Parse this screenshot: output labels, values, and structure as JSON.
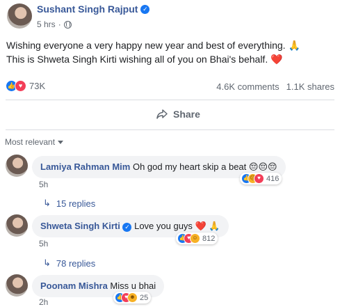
{
  "post": {
    "author": "Sushant Singh Rajput",
    "time": "5 hrs",
    "time_separator": "·",
    "text_line1": "Wishing everyone a very happy new year and best of everything.",
    "text_line1_emoji": "🙏",
    "text_line2": "This is Shweta Singh Kirti wishing all of you on Bhai's behalf.",
    "text_line2_emoji": "❤️",
    "reaction_count": "73K",
    "comments_count": "4.6K comments",
    "shares_count": "1.1K shares",
    "share_label": "Share"
  },
  "comments_section": {
    "sort_label": "Most relevant",
    "comments": [
      {
        "name": "Lamiya Rahman Mim",
        "text": "Oh god my heart skip a beat",
        "emojis": "😔😔😔",
        "time": "5h",
        "reaction_count": "416",
        "replies_label": "15 replies"
      },
      {
        "name": "Shweta Singh Kirti",
        "text": "Love you guys",
        "emojis": "❤️ 🙏",
        "time": "5h",
        "reaction_count": "812",
        "replies_label": "78 replies"
      },
      {
        "name": "Poonam Mishra",
        "text": "Miss u bhai",
        "time": "2h",
        "reaction_count": "25"
      }
    ]
  },
  "colors": {
    "link": "#385898",
    "like": "#1877f2",
    "love": "#f33e58",
    "muted": "#606770",
    "bubble": "#f2f3f5"
  }
}
